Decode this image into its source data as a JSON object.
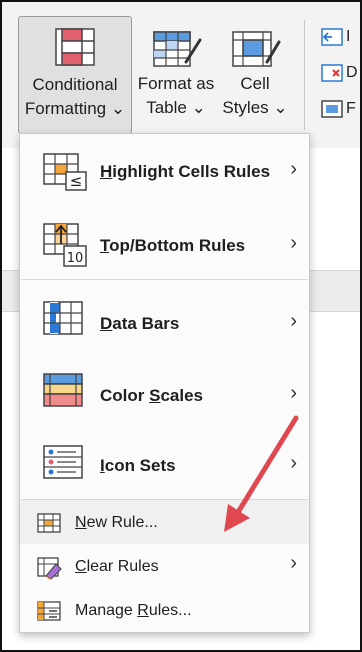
{
  "ribbon": {
    "conditional_formatting": {
      "line1": "Conditional",
      "line2": "Formatting"
    },
    "format_as_table": {
      "line1": "Format as",
      "line2": "Table"
    },
    "cell_styles": {
      "line1": "Cell",
      "line2": "Styles"
    },
    "dropdown_glyph": "⌄",
    "mini_buttons": [
      {
        "name": "insert-icon",
        "label": "I"
      },
      {
        "name": "delete-icon",
        "label": "D"
      },
      {
        "name": "format-icon",
        "label": "F"
      }
    ]
  },
  "menu": {
    "items": [
      {
        "label": "Highlight Cells Rules",
        "underline_char": "H",
        "has_submenu": true
      },
      {
        "label": "Top/Bottom Rules",
        "underline_char": "T",
        "has_submenu": true
      },
      {
        "label": "Data Bars",
        "underline_char": "D",
        "has_submenu": true
      },
      {
        "label": "Color Scales",
        "underline_char": "S",
        "has_submenu": true
      },
      {
        "label": "Icon Sets",
        "underline_char": "I",
        "has_submenu": true
      }
    ],
    "small_items": [
      {
        "label": "New Rule...",
        "underline_char": "N",
        "has_submenu": false
      },
      {
        "label": "Clear Rules",
        "underline_char": "C",
        "has_submenu": true
      },
      {
        "label": "Manage Rules...",
        "underline_char": "R",
        "has_submenu": false
      }
    ],
    "top_bottom_icon_number": "10",
    "highlight_icon_symbol": "≤"
  },
  "colors": {
    "accent_blue": "#2b78d6",
    "orange": "#f4a73b",
    "red": "#e06070",
    "arrow": "#e0484f"
  }
}
